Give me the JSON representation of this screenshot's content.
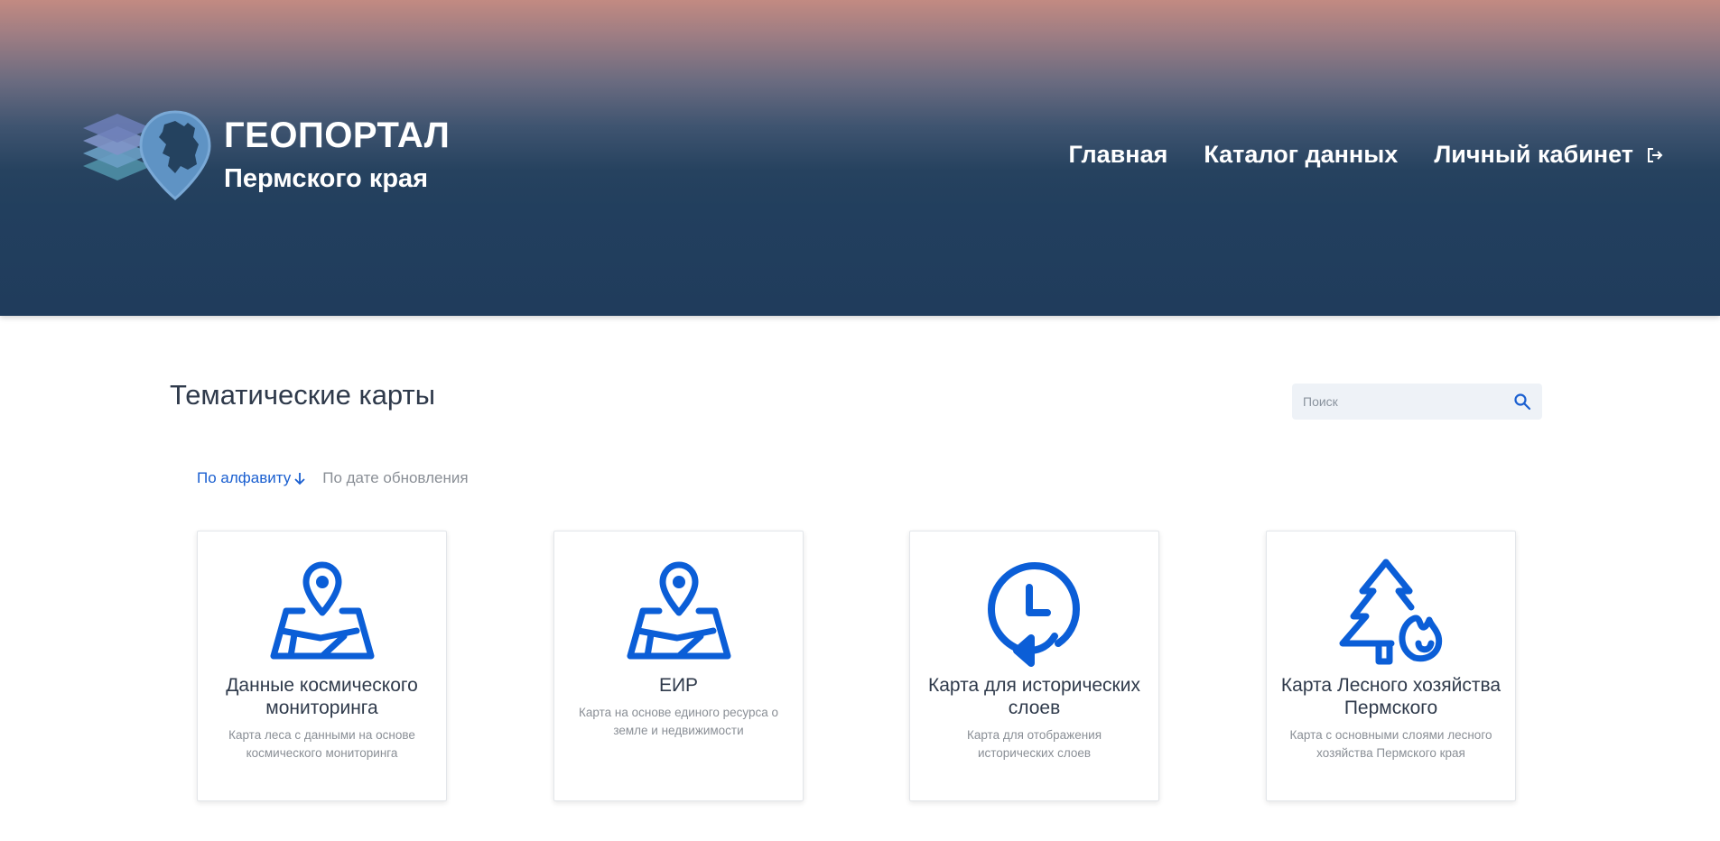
{
  "header": {
    "logo_title": "ГЕОПОРТАЛ",
    "logo_subtitle": "Пермского края",
    "nav": [
      {
        "label": "Главная"
      },
      {
        "label": "Каталог данных"
      },
      {
        "label": "Личный кабинет",
        "icon": "exit-icon"
      }
    ]
  },
  "main": {
    "title": "Тематические карты",
    "search": {
      "placeholder": "Поиск",
      "value": ""
    },
    "sort": {
      "active": "По алфавиту",
      "other": "По дате обновления"
    },
    "cards": [
      {
        "title": "Данные космического мониторинга",
        "description": "Карта леса с данными на основе космического мониторинга",
        "icon": "map-pin-icon"
      },
      {
        "title": "ЕИР",
        "description": "Карта на основе единого ресурса о земле и недвижимости",
        "icon": "map-pin-icon"
      },
      {
        "title": "Карта для исторических слоев",
        "description": "Карта для отображения исторических слоев",
        "icon": "history-clock-icon"
      },
      {
        "title": "Карта Лесного хозяйства Пермского",
        "description": "Карта с основными слоями лесного хозяйства Пермского края",
        "icon": "forest-fire-icon"
      }
    ]
  },
  "colors": {
    "accent": "#1a5fd0",
    "header_dark": "#203c5c",
    "header_top": "#c28a82",
    "icon_blue": "#0b5ed7"
  }
}
